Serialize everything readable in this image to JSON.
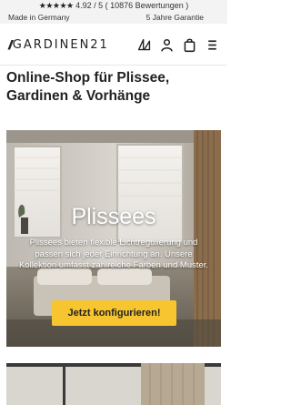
{
  "topbar": {
    "stars": "★★★★★",
    "rating_text": "4.92 / 5 ( 10876 Bewertungen )",
    "made_in": "Made in Germany",
    "guarantee": "5 Jahre Garantie"
  },
  "header": {
    "logo_slashes": "//",
    "logo_text": "GARDINEN21",
    "icons": [
      "fabric-sample-icon",
      "user-icon",
      "shopping-bag-icon",
      "menu-icon"
    ]
  },
  "main": {
    "page_title": "Online-Shop für Plissee, Gardinen & Vorhänge",
    "hero": {
      "title": "Plissees",
      "description": "Plissees bieten flexible Lichtregulierung und passen sich jeder Einrichtung an. Unsere Kollektion umfasst zahlreiche Farben und Muster.",
      "cta_label": "Jetzt konfigurieren!"
    }
  },
  "colors": {
    "accent": "#f7c530",
    "topbar_bg": "#f3f3f3",
    "text": "#222222"
  }
}
